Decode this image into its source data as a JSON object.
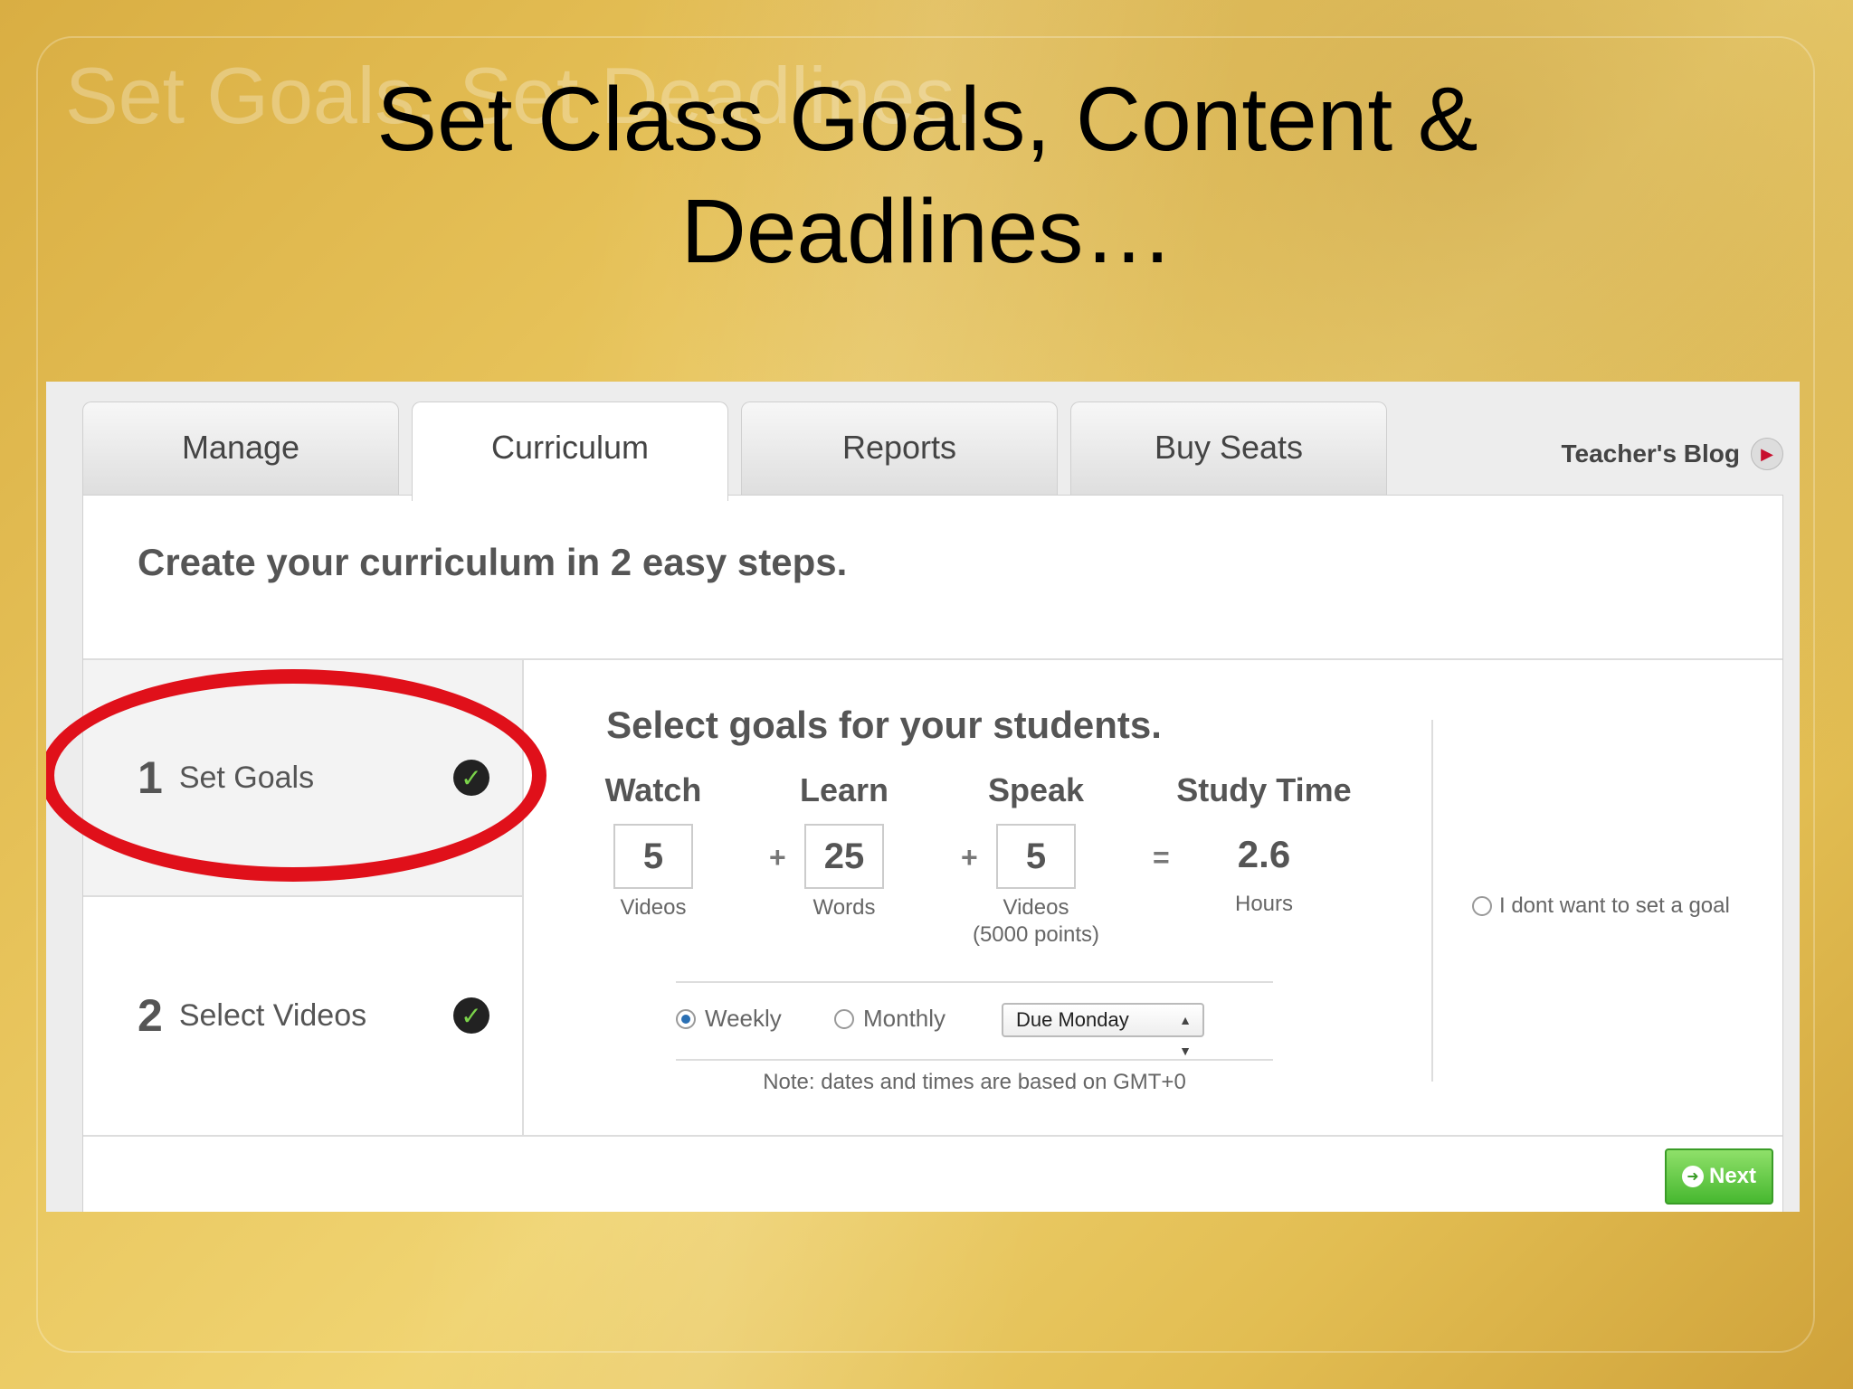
{
  "slide": {
    "title_line1": "Set Class Goals, Content &",
    "title_line2": "Deadlines…",
    "bg_text": "Set Goals. Set Deadlines."
  },
  "tabs": [
    {
      "label": "Manage",
      "active": false
    },
    {
      "label": "Curriculum",
      "active": true
    },
    {
      "label": "Reports",
      "active": false
    },
    {
      "label": "Buy Seats",
      "active": false
    }
  ],
  "teachers_blog": {
    "label": "Teacher's Blog",
    "icon": "play-arrow-icon"
  },
  "headline": "Create your curriculum in 2 easy steps.",
  "steps": [
    {
      "number": "1",
      "label": "Set Goals",
      "complete": true,
      "icon": "check-circle-icon"
    },
    {
      "number": "2",
      "label": "Select Videos",
      "complete": true,
      "icon": "check-circle-icon"
    }
  ],
  "goals": {
    "title": "Select goals for your students.",
    "watch": {
      "heading": "Watch",
      "value": "5",
      "unit": "Videos"
    },
    "learn": {
      "heading": "Learn",
      "value": "25",
      "unit": "Words"
    },
    "speak": {
      "heading": "Speak",
      "value": "5",
      "unit": "Videos",
      "unit2": "(5000 points)"
    },
    "study_time": {
      "heading": "Study Time",
      "value": "2.6",
      "unit": "Hours"
    },
    "op_plus": "+",
    "op_equals": "="
  },
  "frequency": {
    "weekly_label": "Weekly",
    "monthly_label": "Monthly",
    "selected": "Weekly",
    "due": "Due Monday"
  },
  "note": "Note: dates and times are based on GMT+0",
  "no_goal_label": "I dont want to set a goal",
  "next_button": {
    "label": "Next",
    "icon": "arrow-right-circle-icon"
  },
  "colors": {
    "highlight_oval": "#e0101a",
    "next_green": "#47b830",
    "check_green": "#7bd44a"
  }
}
